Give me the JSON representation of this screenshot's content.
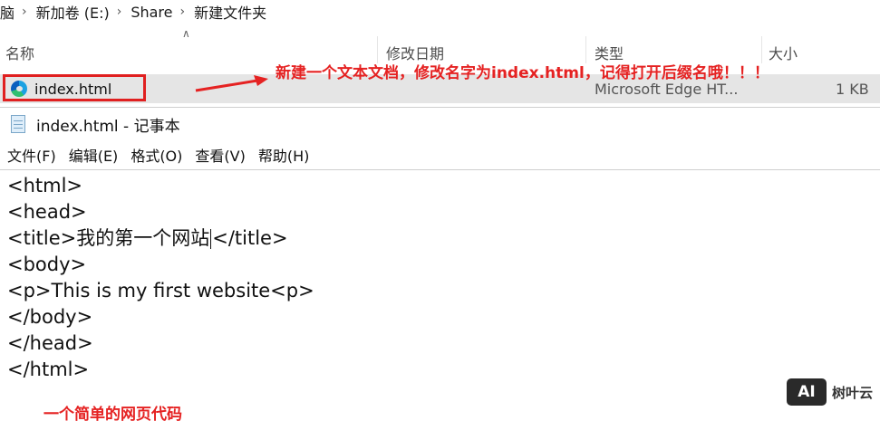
{
  "explorer": {
    "breadcrumb": [
      "脑",
      "新加卷 (E:)",
      "Share",
      "新建文件夹"
    ],
    "columns": {
      "name": "名称",
      "modified": "修改日期",
      "type": "类型",
      "size": "大小"
    },
    "file": {
      "name": "index.html",
      "type": "Microsoft Edge HT...",
      "size": "1 KB"
    }
  },
  "annotations": {
    "top": "新建一个文本文档，修改名字为index.html，记得打开后缀名哦！！！",
    "bottom": "一个简单的网页代码"
  },
  "notepad": {
    "title": "index.html - 记事本",
    "menu": [
      "文件(F)",
      "编辑(E)",
      "格式(O)",
      "查看(V)",
      "帮助(H)"
    ],
    "lines": [
      "<html>",
      "<head>",
      "<title>我的第一个网站</title>",
      "<body>",
      "<p>This is my first website<p>",
      "</body>",
      "</head>",
      "</html>"
    ],
    "title_line_before_caret": "<title>我的第一个网站",
    "title_line_after_caret": "</title>"
  },
  "watermark": {
    "logo": "AI",
    "text": "树叶云"
  },
  "colors": {
    "annotation_red": "#e52222",
    "selection_gray": "#e5e5e5"
  }
}
